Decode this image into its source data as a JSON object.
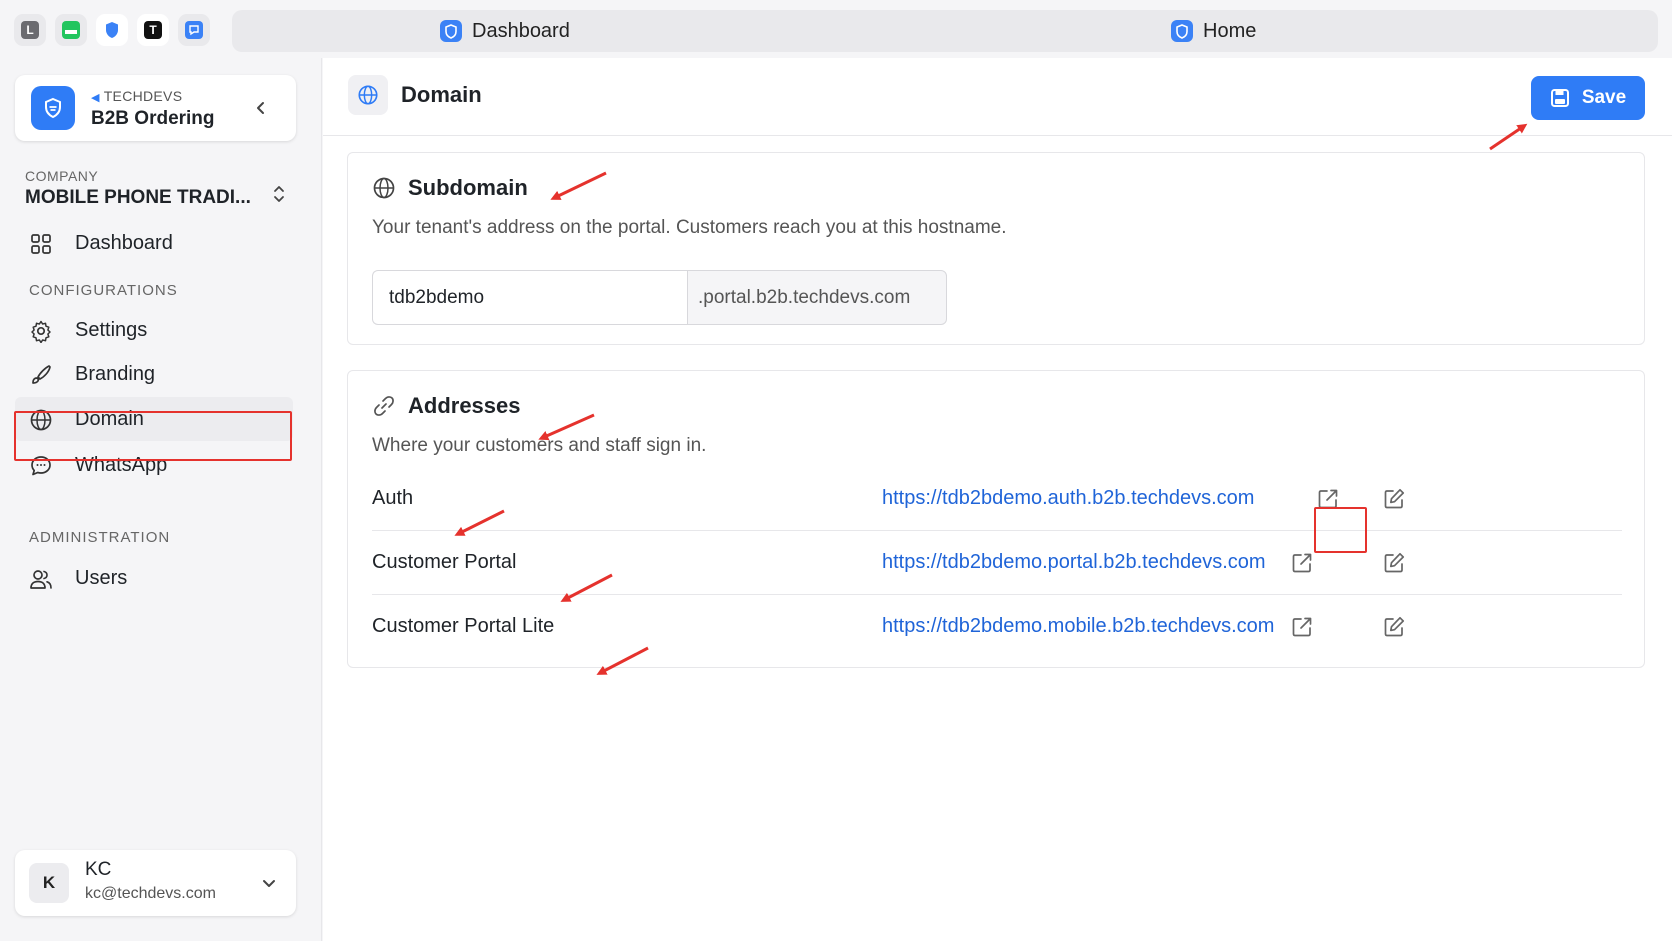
{
  "browser": {
    "pinned_tabs": [
      {
        "icon": "l-app-icon",
        "letter": "L",
        "color": "#6b6b70"
      },
      {
        "icon": "green-app-icon",
        "letter": "",
        "color": "#22c55e"
      },
      {
        "icon": "shield-app-icon",
        "letter": "",
        "color": "#3b82f6"
      },
      {
        "icon": "t-app-icon",
        "letter": "T",
        "color": "#111111"
      },
      {
        "icon": "chat-app-icon",
        "letter": "",
        "color": "#3b82f6"
      }
    ],
    "tabs": [
      {
        "label": "Dashboard",
        "icon": "shield-favicon-icon"
      },
      {
        "label": "Home",
        "icon": "shield-favicon-icon"
      }
    ]
  },
  "sidebar": {
    "app": {
      "org": "TECHDEVS",
      "name": "B2B Ordering"
    },
    "company": {
      "label": "COMPANY",
      "name": "MOBILE PHONE TRADI..."
    },
    "dashboard_label": "Dashboard",
    "sections": {
      "configurations": "CONFIGURATIONS",
      "administration": "ADMINISTRATION"
    },
    "items": {
      "settings": "Settings",
      "branding": "Branding",
      "domain": "Domain",
      "whatsapp": "WhatsApp",
      "users": "Users"
    },
    "active_item": "domain",
    "user": {
      "initial": "K",
      "name": "KC",
      "email": "kc@techdevs.com"
    }
  },
  "header": {
    "title": "Domain",
    "save_label": "Save"
  },
  "subdomain": {
    "title": "Subdomain",
    "description": "Your tenant's address on the portal. Customers reach you at this hostname.",
    "value": "tdb2bdemo",
    "suffix": ".portal.b2b.techdevs.com"
  },
  "addresses": {
    "title": "Addresses",
    "description": "Where your customers and staff sign in.",
    "rows": [
      {
        "label": "Auth",
        "url": "https://tdb2bdemo.auth.b2b.techdevs.com"
      },
      {
        "label": "Customer Portal",
        "url": "https://tdb2bdemo.portal.b2b.techdevs.com"
      },
      {
        "label": "Customer Portal Lite",
        "url": "https://tdb2bdemo.mobile.b2b.techdevs.com"
      }
    ]
  },
  "colors": {
    "accent": "#2f7cf6",
    "link": "#1f64d8",
    "annotation": "#e5322d"
  }
}
